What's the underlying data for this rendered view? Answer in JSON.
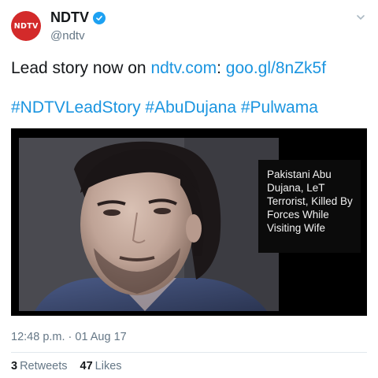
{
  "account": {
    "avatar_text": "NDTV",
    "display_name": "NDTV",
    "handle": "@ndtv",
    "verified": true,
    "avatar_color": "#d32a2a"
  },
  "tweet": {
    "text_prefix": "Lead story now on ",
    "link_domain": "ndtv.com",
    "separator": ": ",
    "short_url": "goo.gl/8nZk5f",
    "hashtags": [
      "#NDTVLeadStory",
      "#AbuDujana",
      "#Pulwama"
    ]
  },
  "media": {
    "caption": "Pakistani Abu Dujana, LeT Terrorist, Killed By Forces While Visiting Wife"
  },
  "meta": {
    "timestamp": "12:48 p.m. · 01 Aug 17"
  },
  "stats": {
    "retweets_count": "3",
    "retweets_label": "Retweets",
    "likes_count": "47",
    "likes_label": "Likes"
  },
  "icons": {
    "verified": "verified-badge-icon",
    "menu": "chevron-down-icon"
  },
  "colors": {
    "link": "#1b95e0",
    "muted": "#657786",
    "verified": "#1da1f2"
  }
}
